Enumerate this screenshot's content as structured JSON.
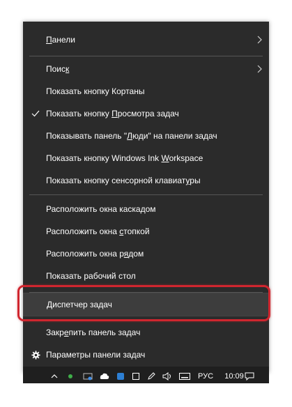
{
  "menu": {
    "items": [
      {
        "label_pre": "",
        "label_u": "П",
        "label_post": "анели"
      },
      {
        "label_pre": "Поис",
        "label_u": "к",
        "label_post": ""
      },
      {
        "label_pre": "Показать кнопку Кортаны",
        "label_u": "",
        "label_post": ""
      },
      {
        "label_pre": "Показать кнопку ",
        "label_u": "П",
        "label_post": "росмотра задач"
      },
      {
        "label_pre": "Показывать панель \"",
        "label_u": "Л",
        "label_post": "юди\" на панели задач"
      },
      {
        "label_pre": "Показать кнопку Windows Ink ",
        "label_u": "W",
        "label_post": "orkspace"
      },
      {
        "label_pre": "Показать кнопку сенсорной клавиат",
        "label_u": "у",
        "label_post": "ры"
      },
      {
        "label_pre": "Расположить окна каскадом",
        "label_u": "",
        "label_post": ""
      },
      {
        "label_pre": "Расположить окна ",
        "label_u": "с",
        "label_post": "топкой"
      },
      {
        "label_pre": "Расположить окна р",
        "label_u": "я",
        "label_post": "дом"
      },
      {
        "label_pre": "Показать рабочий стол",
        "label_u": "",
        "label_post": ""
      },
      {
        "label_pre": "Диспетчер задач",
        "label_u": "",
        "label_post": ""
      },
      {
        "label_pre": "Закр",
        "label_u": "е",
        "label_post": "пить панель задач"
      },
      {
        "label_pre": "Параметры панели задач",
        "label_u": "",
        "label_post": ""
      }
    ]
  },
  "taskbar": {
    "language": "РУС",
    "time": "10:09"
  },
  "colors": {
    "menu_bg": "#2b2b2b",
    "highlight_border": "#d0262f"
  },
  "icons": {
    "checked": "check-icon",
    "settings": "gear-icon",
    "submenu": "chevron-right-icon"
  }
}
